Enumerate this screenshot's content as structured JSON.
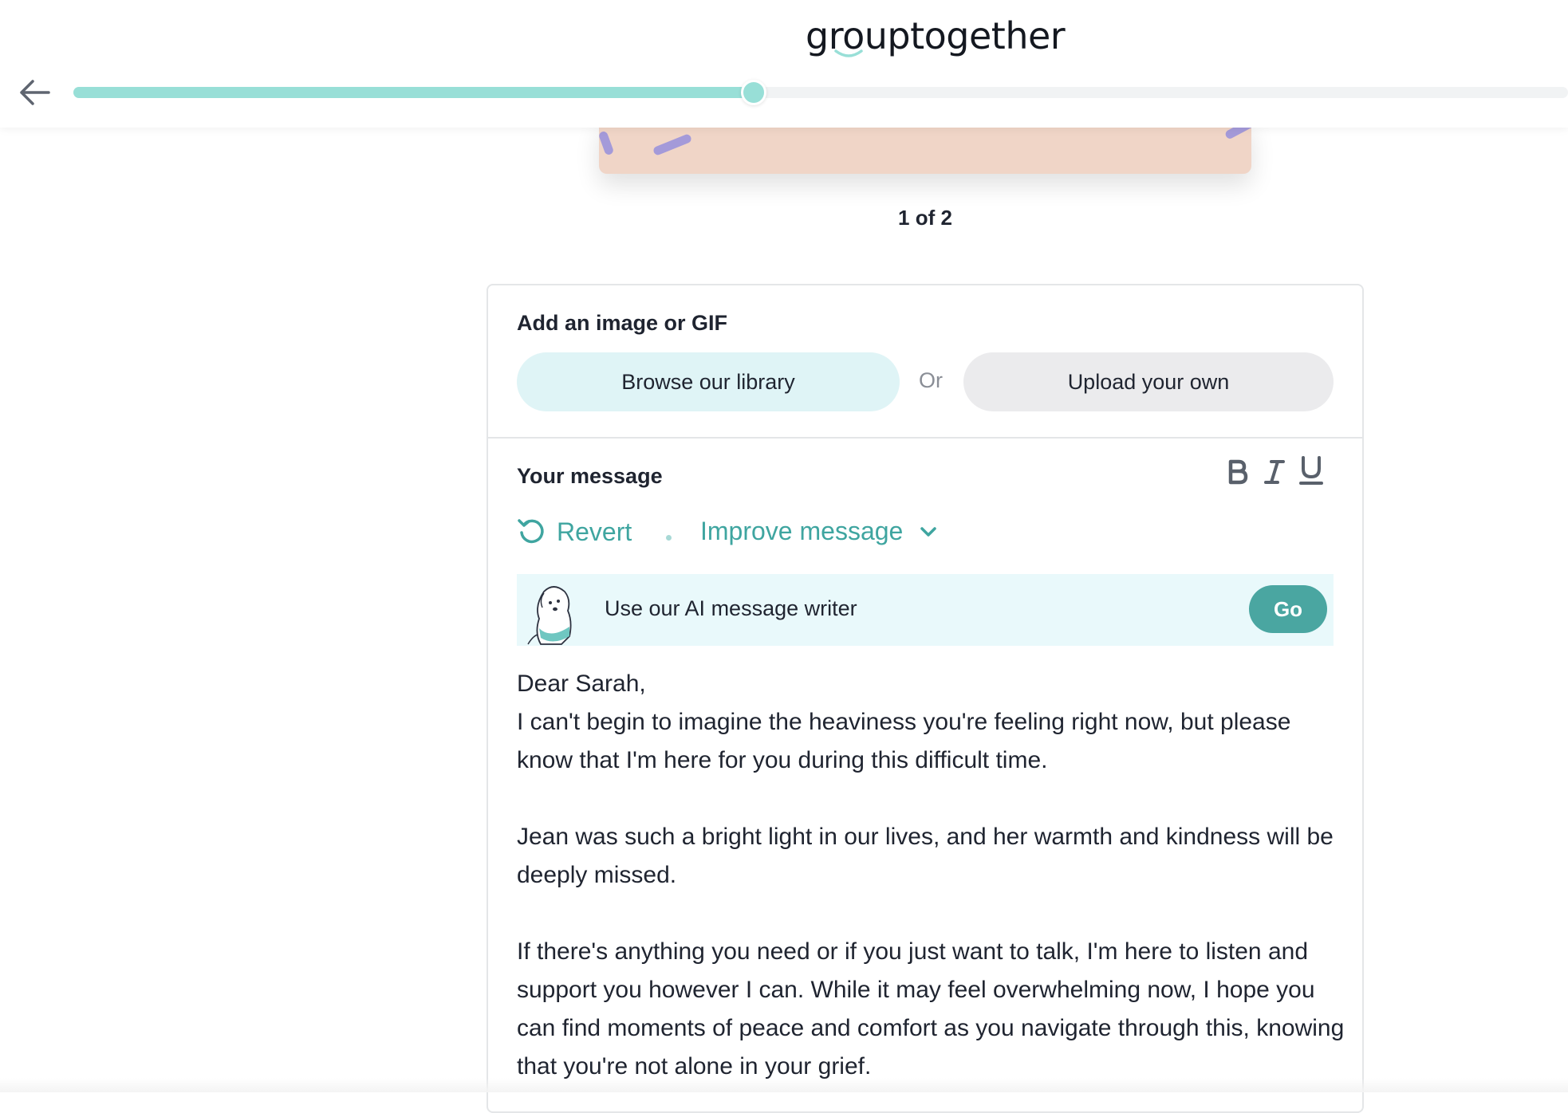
{
  "header": {
    "logo_text": "grouptogether",
    "back_icon": "arrow-left-icon",
    "progress_percent": 45.5,
    "accent_color": "#98dfd7"
  },
  "carousel": {
    "pager_text": "1 of 2"
  },
  "image_section": {
    "title": "Add an image or GIF",
    "browse_label": "Browse our library",
    "or_label": "Or",
    "upload_label": "Upload your own"
  },
  "message_section": {
    "title": "Your message",
    "format_buttons": [
      "B",
      "I",
      "U"
    ],
    "revert_label": "Revert",
    "improve_label": "Improve message",
    "ai_writer_label": "Use our AI message writer",
    "go_label": "Go",
    "go_color": "#4aa6a1",
    "link_color": "#3fa5a0",
    "paragraphs": [
      "Dear Sarah,",
      "I can't begin to imagine the heaviness you're feeling right now, but please know that I'm here for you during this difficult time.",
      "Jean was such a bright light in our lives, and her warmth and kindness will be deeply missed.",
      "If there's anything you need or if you just want to talk, I'm here to listen and support you however I can. While it may feel overwhelming now, I hope you can find moments of peace and comfort as you navigate through this, knowing that you're not alone in your grief."
    ]
  }
}
